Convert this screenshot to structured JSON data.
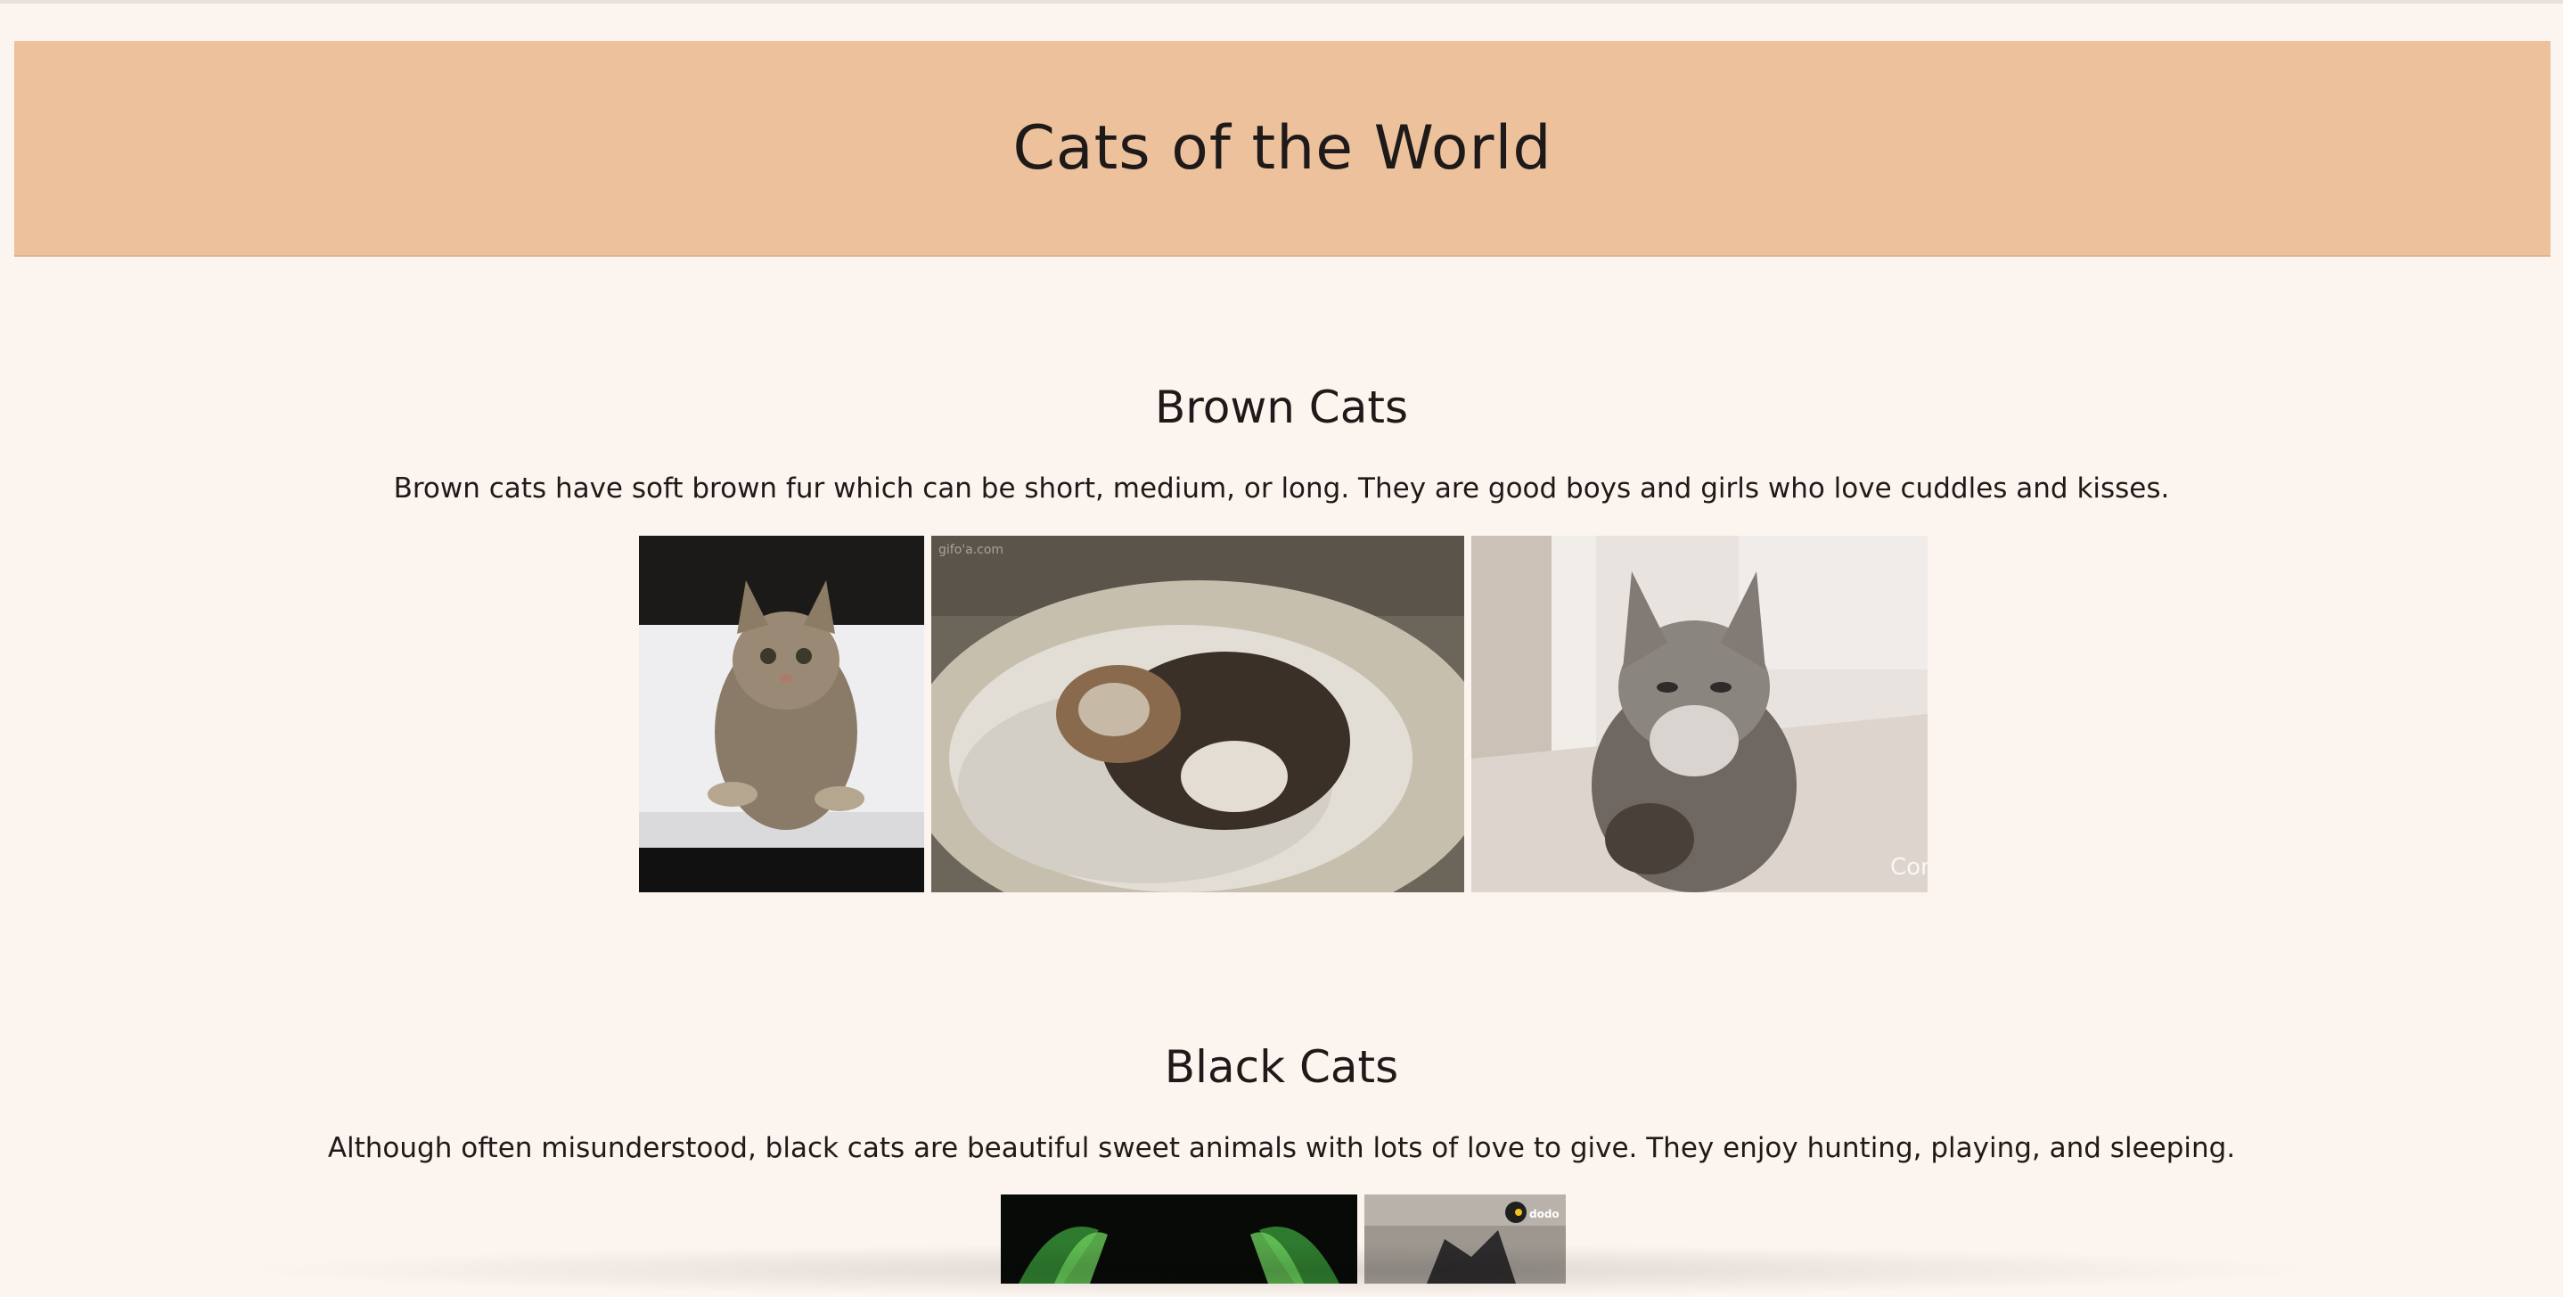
{
  "page": {
    "title": "Cats of the World"
  },
  "sections": [
    {
      "title": "Brown Cats",
      "description": "Brown cats have soft brown fur which can be short, medium, or long. They are good boys and girls who love cuddles and kisses.",
      "images": [
        {
          "name": "brown-cat-photo-1"
        },
        {
          "name": "kitten-sleeping-photo",
          "watermark": "gifo'a.com"
        },
        {
          "name": "fluffy-kitten-photo",
          "watermark": "Com"
        }
      ]
    },
    {
      "title": "Black Cats",
      "description": "Although often misunderstood, black cats are beautiful sweet animals with lots of love to give. They enjoy hunting, playing, and sleeping.",
      "images": [
        {
          "name": "black-cat-green-photo"
        },
        {
          "name": "black-cat-dodo-photo",
          "watermark": "dodo"
        }
      ]
    }
  ],
  "colors": {
    "background": "#fcf4ee",
    "header": "#edc19c",
    "text": "#1f1a1a"
  }
}
